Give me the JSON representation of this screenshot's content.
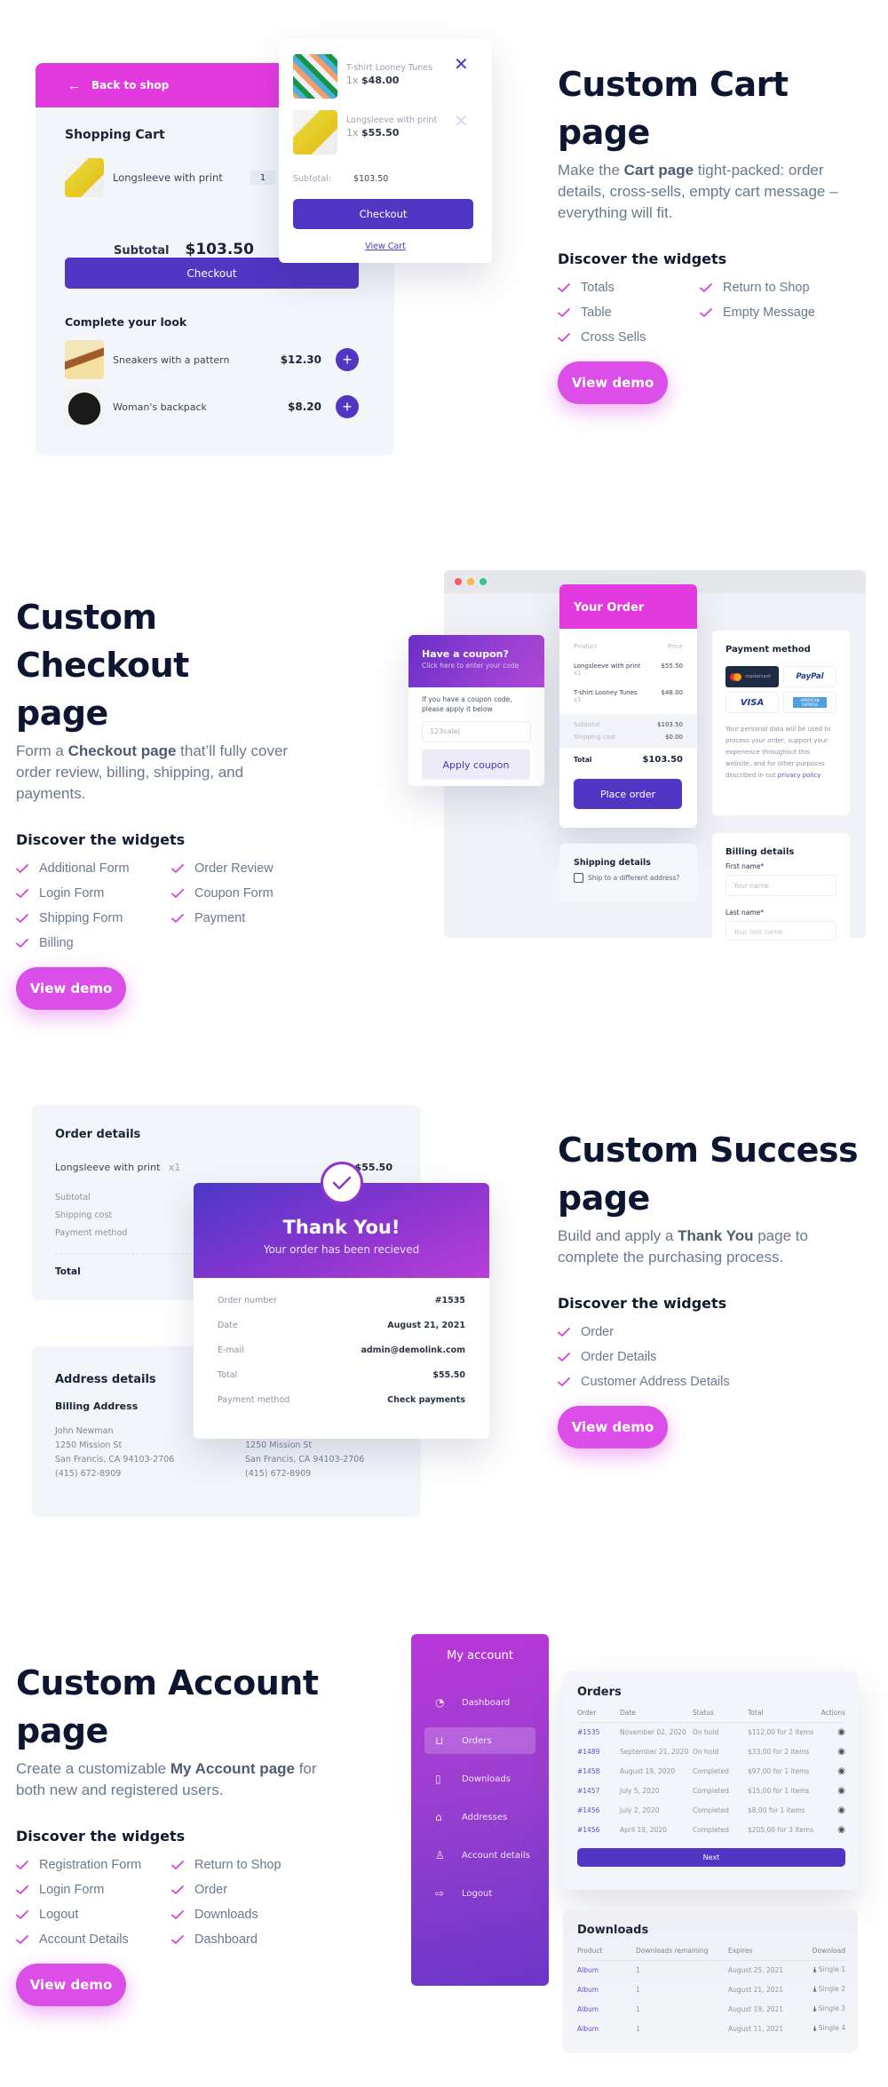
{
  "colors": {
    "magenta": "#e33ae0",
    "purple": "#5135c3",
    "button_pink": "#dc4ee8",
    "check": "#d63fe0"
  },
  "sections": {
    "cart": {
      "title_line1": "Custom Cart",
      "title_line2": "page",
      "desc_pre": "Make the ",
      "desc_bold": "Cart page",
      "desc_post": " tight-packed: order details, cross-sells, empty cart message – everything will fit.",
      "widgets_heading": "Discover the widgets",
      "widgets": [
        "Totals",
        "Return to Shop",
        "Table",
        "Empty Message",
        "Cross Sells"
      ],
      "demo_label": "View demo"
    },
    "checkout": {
      "title_line1": "Custom Checkout",
      "title_line2": "page",
      "desc_pre": "Form a ",
      "desc_bold": "Checkout page",
      "desc_post": " that’ll fully cover order review, billing, shipping, and payments.",
      "widgets_heading": "Discover the widgets",
      "widgets": [
        "Additional Form",
        "Order Review",
        "Login Form",
        "Coupon Form",
        "Shipping Form",
        "Payment",
        "Billing"
      ],
      "demo_label": "View demo"
    },
    "success": {
      "title_line1": "Custom Success",
      "title_line2": "page",
      "desc_pre": "Build and apply a ",
      "desc_bold": "Thank You",
      "desc_post": " page to complete the purchasing process.",
      "widgets_heading": "Discover the widgets",
      "widgets": [
        "Order",
        "Order Details",
        "Customer Address Details"
      ],
      "demo_label": "View demo"
    },
    "account": {
      "title_line1": "Custom Account",
      "title_line2": "page",
      "desc_pre": "Create a customizable ",
      "desc_bold": "My Account page",
      "desc_post": " for both new and registered users.",
      "widgets_heading": "Discover the widgets",
      "widgets": [
        "Registration Form",
        "Return to Shop",
        "Login Form",
        "Order",
        "Logout",
        "Downloads",
        "Account Details",
        "Dashboard"
      ],
      "demo_label": "View demo"
    }
  },
  "cart_mock": {
    "back_label": "Back to shop",
    "heading": "Shopping Cart",
    "item": {
      "name": "Longsleeve with print",
      "qty": "1"
    },
    "subtotal_label": "Subtotal",
    "subtotal_value": "$103.50",
    "checkout_label": "Checkout",
    "crosssell_heading": "Complete your look",
    "crosssells": [
      {
        "name": "Sneakers with a pattern",
        "price": "$12.30"
      },
      {
        "name": "Woman's backpack",
        "price": "$8.20"
      }
    ],
    "mini": {
      "items": [
        {
          "name": "T-shirt Looney Tunes",
          "qty": "1x",
          "price": "$48.00"
        },
        {
          "name": "Longsleeve with print",
          "qty": "1x",
          "price": "$55.50"
        }
      ],
      "subtotal_label": "Subtotal:",
      "subtotal_value": "$103.50",
      "checkout_label": "Checkout",
      "view_cart_label": "View Cart"
    }
  },
  "checkout_mock": {
    "coupon": {
      "title": "Have a coupon?",
      "subtitle": "Click here to enter your code",
      "text": "If you have a coupon code, please apply it below",
      "input_value": "123sale|",
      "button": "Apply coupon"
    },
    "order": {
      "title": "Your Order",
      "col_product": "Product",
      "col_price": "Price",
      "items": [
        {
          "name": "Longsleeve with print",
          "qty": "x1",
          "price": "$55.50"
        },
        {
          "name": "T-shirt Looney Tunes",
          "qty": "x1",
          "price": "$48.00"
        }
      ],
      "subtotal_label": "Subtotal",
      "subtotal_value": "$103.50",
      "shipping_label": "Shipping cost",
      "shipping_value": "$0.00",
      "total_label": "Total",
      "total_value": "$103.50",
      "place_order": "Place order"
    },
    "payment": {
      "title": "Payment method",
      "cards": [
        "mastercard",
        "PayPal",
        "VISA",
        "AMERICAN EXPRESS"
      ],
      "privacy_text": "Your personal data will be used to process your order, support your experience throughout this website, and for other purposes described in out ",
      "privacy_link": "privacy policy",
      "privacy_end": "."
    },
    "shipping": {
      "title": "Shipping details",
      "checkbox_label": "Ship to a different address?"
    },
    "billing": {
      "title": "Billing details",
      "first_label": "First name*",
      "first_placeholder": "Your name",
      "last_label": "Last name*",
      "last_placeholder": "Your last name"
    }
  },
  "success_mock": {
    "order_details": {
      "title": "Order details",
      "item": "Longsleeve with print",
      "qty": "x1",
      "price": "$55.50",
      "subtotal": "Subtotal",
      "shipping": "Shipping cost",
      "payment": "Payment method",
      "total": "Total"
    },
    "address": {
      "title": "Address details",
      "billing_title": "Billing Address",
      "lines": [
        "John Newman",
        "1250 Mission St",
        "San Francis, CA 94103-2706",
        "(415) 672-8909"
      ]
    },
    "thanks": {
      "title": "Thank You!",
      "subtitle": "Your order has been recieved",
      "rows": [
        {
          "label": "Order number",
          "value": "#1535"
        },
        {
          "label": "Date",
          "value": "August 21, 2021"
        },
        {
          "label": "E-mail",
          "value": "admin@demolink.com"
        },
        {
          "label": "Total",
          "value": "$55.50"
        },
        {
          "label": "Payment method",
          "value": "Check payments"
        }
      ]
    }
  },
  "account_mock": {
    "sidebar_title": "My account",
    "menu": [
      {
        "label": "Dashboard",
        "icon": "dashboard-icon"
      },
      {
        "label": "Orders",
        "icon": "basket-icon",
        "active": true
      },
      {
        "label": "Downloads",
        "icon": "file-download-icon"
      },
      {
        "label": "Addresses",
        "icon": "home-icon"
      },
      {
        "label": "Account details",
        "icon": "user-icon"
      },
      {
        "label": "Logout",
        "icon": "logout-icon"
      }
    ],
    "orders": {
      "title": "Orders",
      "headers": [
        "Order",
        "Date",
        "Status",
        "Total",
        "Actions"
      ],
      "rows": [
        [
          "#1535",
          "November 02, 2020",
          "On hold",
          "$112,00 for 2 items"
        ],
        [
          "#1489",
          "September 21, 2020",
          "On hold",
          "$33,00 for 2 items"
        ],
        [
          "#1458",
          "August 19, 2020",
          "Completed",
          "$97,00 for 1 items"
        ],
        [
          "#1457",
          "July 5, 2020",
          "Completed",
          "$15,00 for 1 items"
        ],
        [
          "#1456",
          "July 2, 2020",
          "Completed",
          "$8,00 for 1 items"
        ],
        [
          "#1456",
          "April 19, 2020",
          "Completed",
          "$205,00 for 3 items"
        ]
      ],
      "next_label": "Next"
    },
    "downloads": {
      "title": "Downloads",
      "headers": [
        "Product",
        "Downloads remaining",
        "Expires",
        "Download"
      ],
      "rows": [
        [
          "Album",
          "1",
          "August 25, 2021",
          "Single 1"
        ],
        [
          "Album",
          "1",
          "August 21, 2021",
          "Single 2"
        ],
        [
          "Album",
          "1",
          "August 19, 2021",
          "Single 3"
        ],
        [
          "Album",
          "1",
          "August 11, 2021",
          "Single 4"
        ]
      ]
    }
  }
}
